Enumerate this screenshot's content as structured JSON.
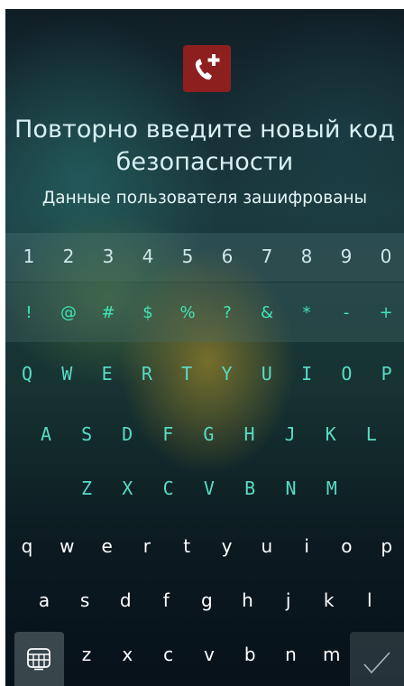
{
  "header": {
    "icon": "phone-plus-icon",
    "title_line1": "Повторно введите новый код",
    "title_line2": "безопасности",
    "subtitle": "Данные пользователя зашифрованы"
  },
  "keyboard": {
    "digits": [
      "1",
      "2",
      "3",
      "4",
      "5",
      "6",
      "7",
      "8",
      "9",
      "0"
    ],
    "symbols": [
      "!",
      "@",
      "#",
      "$",
      "%",
      "?",
      "&",
      "*",
      "-",
      "+"
    ],
    "upper1": [
      "Q",
      "W",
      "E",
      "R",
      "T",
      "Y",
      "U",
      "I",
      "O",
      "P"
    ],
    "upper2": [
      "A",
      "S",
      "D",
      "F",
      "G",
      "H",
      "J",
      "K",
      "L"
    ],
    "upper3": [
      "Z",
      "X",
      "C",
      "V",
      "B",
      "N",
      "M"
    ],
    "lower1": [
      "q",
      "w",
      "e",
      "r",
      "t",
      "y",
      "u",
      "i",
      "o",
      "p"
    ],
    "lower2": [
      "a",
      "s",
      "d",
      "f",
      "g",
      "h",
      "j",
      "k",
      "l"
    ],
    "lower3": [
      "z",
      "x",
      "c",
      "v",
      "b",
      "n",
      "m"
    ],
    "mode_icon": "keyboard-grid-icon",
    "confirm_icon": "checkmark-icon"
  },
  "colors": {
    "icon_bg": "#8e1f1f",
    "symbol_key": "#3fe6b8",
    "upper_key": "#58dcc6",
    "title_text": "#d8f0f2"
  }
}
